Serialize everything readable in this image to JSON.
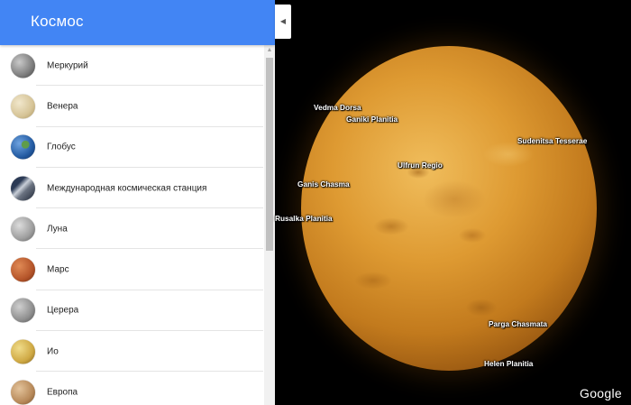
{
  "sidebar": {
    "title": "Космос",
    "items": [
      {
        "label": "Меркурий",
        "thumb": "mercury-thumbnail",
        "color": "#8c8c8c"
      },
      {
        "label": "Венера",
        "thumb": "venus-thumbnail",
        "color": "#d9c9a0"
      },
      {
        "label": "Глобус",
        "thumb": "earth-thumbnail",
        "color": "#2f6db0"
      },
      {
        "label": "Международная космическая станция",
        "thumb": "iss-thumbnail",
        "color": "#4a4f57"
      },
      {
        "label": "Луна",
        "thumb": "moon-thumbnail",
        "color": "#a7a7a7"
      },
      {
        "label": "Марс",
        "thumb": "mars-thumbnail",
        "color": "#b5552a"
      },
      {
        "label": "Церера",
        "thumb": "ceres-thumbnail",
        "color": "#9b9b9b"
      },
      {
        "label": "Ио",
        "thumb": "io-thumbnail",
        "color": "#d1b24a"
      },
      {
        "label": "Европа",
        "thumb": "europa-thumbnail",
        "color": "#b88a5a"
      }
    ]
  },
  "collapse_icon": "triangle-left",
  "map": {
    "planet": "Venus",
    "labels": [
      {
        "key": "vedma",
        "text": "Vedma Dorsa"
      },
      {
        "key": "ganiki",
        "text": "Ganiki Planitia"
      },
      {
        "key": "sudenitsa",
        "text": "Sudenitsa Tesserae"
      },
      {
        "key": "ulfrun",
        "text": "Ulfrun Regio"
      },
      {
        "key": "ganis",
        "text": "Ganis Chasma"
      },
      {
        "key": "rusalka",
        "text": "Rusalka Planitia"
      },
      {
        "key": "parga",
        "text": "Parga Chasmata"
      },
      {
        "key": "helen",
        "text": "Helen Planitia"
      }
    ],
    "logo": "Google"
  },
  "colors": {
    "header": "#4285f4",
    "space": "#000000"
  }
}
